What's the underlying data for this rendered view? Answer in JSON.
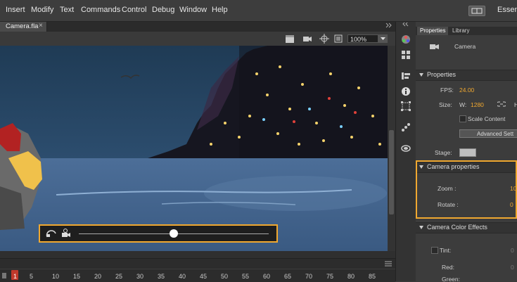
{
  "menu": {
    "items": [
      "Insert",
      "Modify",
      "Text",
      "Commands",
      "Control",
      "Debug",
      "Window",
      "Help"
    ],
    "workspace_label": "Essent"
  },
  "document": {
    "tab_label": "Camera.fla",
    "close_glyph": "×"
  },
  "toolbar": {
    "zoom": "100%"
  },
  "timeline": {
    "frames": [
      "5",
      "10",
      "15",
      "20",
      "25",
      "30",
      "35",
      "40",
      "45",
      "50",
      "55",
      "60",
      "65",
      "70",
      "75",
      "80",
      "85"
    ],
    "current_frame": "1"
  },
  "camera_controls": {
    "slider_value": 0.5
  },
  "panel": {
    "tabs": [
      "Properties",
      "Library"
    ],
    "object_name": "Camera",
    "sections": {
      "properties": "Properties",
      "camera_properties": "Camera properties",
      "color_effects": "Camera Color Effects"
    },
    "fps_label": "FPS:",
    "fps_value": "24.00",
    "size_label": "Size:",
    "width_label": "W:",
    "width_value": "1280",
    "height_label": "H",
    "scale_content": "Scale Content",
    "advanced_settings": "Advanced Sett",
    "stage_label": "Stage:",
    "zoom_label": "Zoom :",
    "zoom_value": "10",
    "rotate_label": "Rotate :",
    "rotate_value": "0",
    "tint_label": "Tint:",
    "tint_value": "0",
    "red_label": "Red:",
    "red_value": "0",
    "green_label": "Green:"
  },
  "colors": {
    "accent": "#f0a830",
    "menubar": "#3d3d3d",
    "panel": "#3c3c3c",
    "playhead": "#c0392b"
  },
  "icons": [
    "camera-icon",
    "lock-icon",
    "grid-icon",
    "info-icon",
    "transform-icon",
    "swatches-icon",
    "color-wheel-icon"
  ]
}
